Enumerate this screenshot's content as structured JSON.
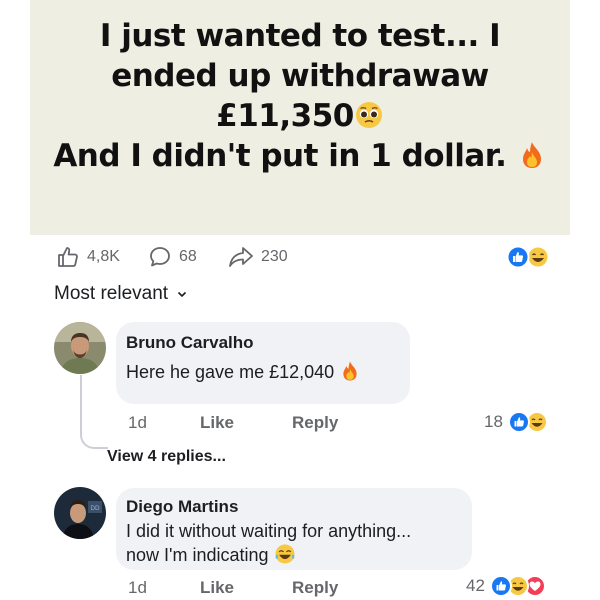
{
  "post": {
    "line1": "I just wanted to test... I",
    "line2": "ended up withdrawaw",
    "line3": "£11,350",
    "line4": "And I didn't put in 1 dollar.",
    "emoji_pleading": "pleading-face-emoji",
    "emoji_fire": "fire-emoji"
  },
  "stats": {
    "likes": "4,8K",
    "comments": "68",
    "shares": "230"
  },
  "sort": {
    "label": "Most relevant"
  },
  "comments": [
    {
      "author": "Bruno Carvalho",
      "text": "Here he gave me £12,040",
      "time": "1d",
      "like": "Like",
      "reply": "Reply",
      "reactions": "18",
      "view_replies": "View 4 replies..."
    },
    {
      "author": "Diego Martins",
      "text_line1": "I did it without waiting for anything...",
      "text_line2": "now I'm indicating",
      "time": "1d",
      "like": "Like",
      "reply": "Reply",
      "reactions": "42"
    }
  ],
  "colors": {
    "like_blue": "#1877f2",
    "love_red": "#f33e58",
    "haha_yellow": "#f7c843",
    "banner_bg": "#eeeee3"
  }
}
